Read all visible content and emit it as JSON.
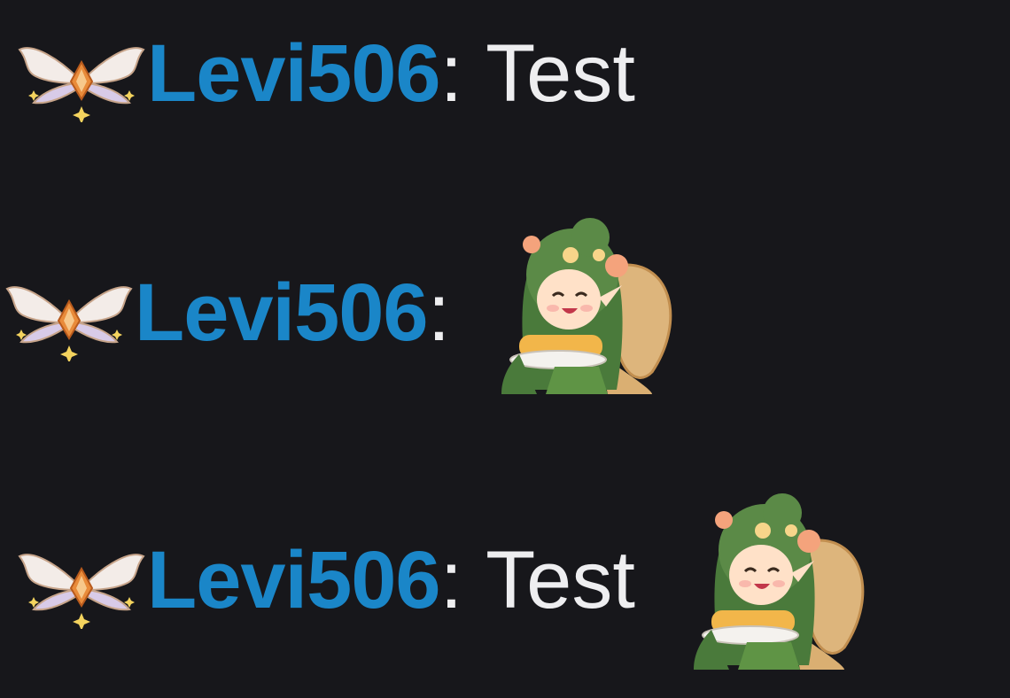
{
  "colors": {
    "background": "#17171b",
    "username": "#1a86c8",
    "text": "#eeeef0"
  },
  "messages": [
    {
      "badge_icon": "winged-gem-badge-icon",
      "username": "Levi506",
      "separator": ":",
      "text": "Test",
      "emote_icon": null
    },
    {
      "badge_icon": "winged-gem-badge-icon",
      "username": "Levi506",
      "separator": ":",
      "text": "",
      "emote_icon": "fairy-eating-cake-emote-icon"
    },
    {
      "badge_icon": "winged-gem-badge-icon",
      "username": "Levi506",
      "separator": ":",
      "text": "Test",
      "emote_icon": "fairy-eating-cake-emote-icon"
    }
  ]
}
